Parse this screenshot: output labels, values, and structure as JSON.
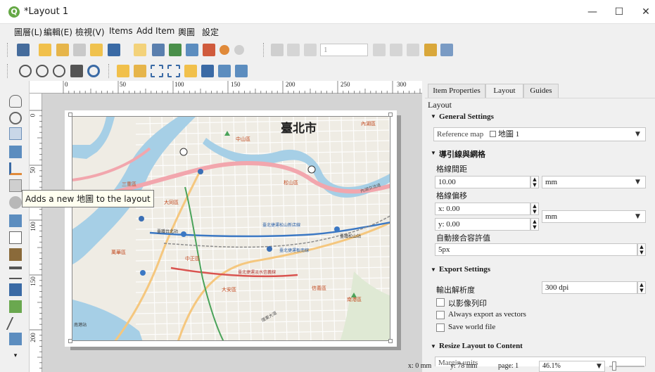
{
  "window": {
    "title": "*Layout 1",
    "minimize": "—",
    "maximize": "☐",
    "close": "✕"
  },
  "menu": [
    "圖層(L)",
    "編輯(E)",
    "檢視(V)",
    "Items",
    "Add Item",
    "輿圖",
    "設定"
  ],
  "toolbar": {
    "page_input": "1"
  },
  "tooltip": "Adds a new 地圖 to the layout",
  "ruler_h_labels": [
    "0",
    "50",
    "100",
    "150",
    "200",
    "250",
    "300"
  ],
  "ruler_v_labels": [
    "0",
    "50",
    "100",
    "150",
    "200"
  ],
  "map_labels": {
    "city": "臺北市",
    "d1": "中山區",
    "d2": "內湖區",
    "d3": "松山區",
    "d4": "大同區",
    "d5": "萬華區",
    "d6": "中正區",
    "d7": "大安區",
    "d8": "信義區",
    "d9": "南港區",
    "d10": "三重區",
    "st1": "臺北捷運松山新店線",
    "st2": "臺北捷運板南線",
    "st3": "臺北捷運淡水信義線",
    "st4": "臺鐵台北站",
    "st5": "南港站",
    "st6": "臺鐵松山站",
    "road1": "內湖交流道",
    "road2": "環東大道"
  },
  "panel": {
    "tabs": [
      "Item Properties",
      "Layout",
      "Guides"
    ],
    "active_tab": "Layout",
    "title": "Layout",
    "general_settings": "General Settings",
    "reference_map_label": "Reference map",
    "reference_map_value": "地圖 1",
    "guides_grid": "導引線與網格",
    "grid_spacing_label": "格線間距",
    "grid_spacing_value": "10.00",
    "grid_spacing_unit": "mm",
    "grid_offset_label": "格線偏移",
    "offset_x": "x: 0.00",
    "offset_y": "y: 0.00",
    "offset_unit": "mm",
    "snap_tol_label": "自動接合容許值",
    "snap_tol_value": "5px",
    "export_settings": "Export Settings",
    "export_res_label": "輸出解析度",
    "export_res_value": "300 dpi",
    "print_raster": "以影像列印",
    "export_vectors": "Always export as vectors",
    "save_world": "Save world file",
    "resize_layout": "Resize Layout to Content",
    "margin_units": "Margin units"
  },
  "status": {
    "x": "x: 0 mm",
    "y": "y: 78 mm",
    "page": "page: 1",
    "zoom": "46.1%"
  },
  "colors": {
    "accent": "#65a845",
    "water": "#aed3e8",
    "river": "#5ba3d6",
    "metro_blue": "#3b78c4",
    "metro_green": "#4aa35a",
    "metro_red": "#d9534f"
  }
}
